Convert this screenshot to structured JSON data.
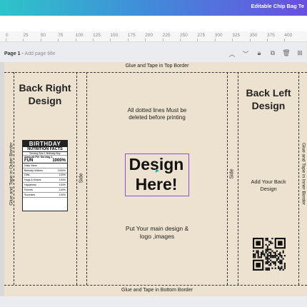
{
  "header": {
    "title": "Editable Chip Bag Te"
  },
  "ruler": {
    "ticks": [
      "0",
      "25",
      "50",
      "75",
      "100",
      "125",
      "150",
      "175",
      "200",
      "225",
      "250",
      "275",
      "300",
      "325",
      "350",
      "375",
      "400"
    ]
  },
  "page": {
    "label": "Page 1",
    "add_title": "Add page title"
  },
  "template": {
    "top_border": "Glue and Tape in Top  Border",
    "bottom_border": "Glue and Tape in Bottom Border",
    "outer_border": "Glue and Tape in Outer Border",
    "inner_border": "Glue and Tape in Inner Border",
    "side_left": "Side",
    "side_right": "Side",
    "back_right_title": "Back Right\nDesign",
    "back_left_title": "Back Left\nDesign",
    "dotted_note": "All dotted lines Must be\ndeleted before printing",
    "design_here": "Design\nHere!",
    "main_note": "Put Your main design &\nlogo ,images",
    "add_back": "Add Your Back\nDesign"
  },
  "nutrition": {
    "title": "BIRTHDAY",
    "subtitle": "NUTRITION FACTS",
    "serving": "Serving Size 1 Birthday Boy",
    "amount": "Amount Per Serving 1",
    "fun_label": "FUN",
    "fun_value": "1000%",
    "dv": "Daily Value",
    "rows": [
      {
        "label": "Birthday Wishes",
        "value": "1000%"
      },
      {
        "label": "Gifts",
        "value": "100%"
      },
      {
        "label": "Hugs & Kisses",
        "value": "100%"
      },
      {
        "label": "Happiness",
        "value": "100%"
      },
      {
        "label": "Friends",
        "value": "100%"
      },
      {
        "label": "Surprises",
        "value": "100%"
      }
    ]
  }
}
